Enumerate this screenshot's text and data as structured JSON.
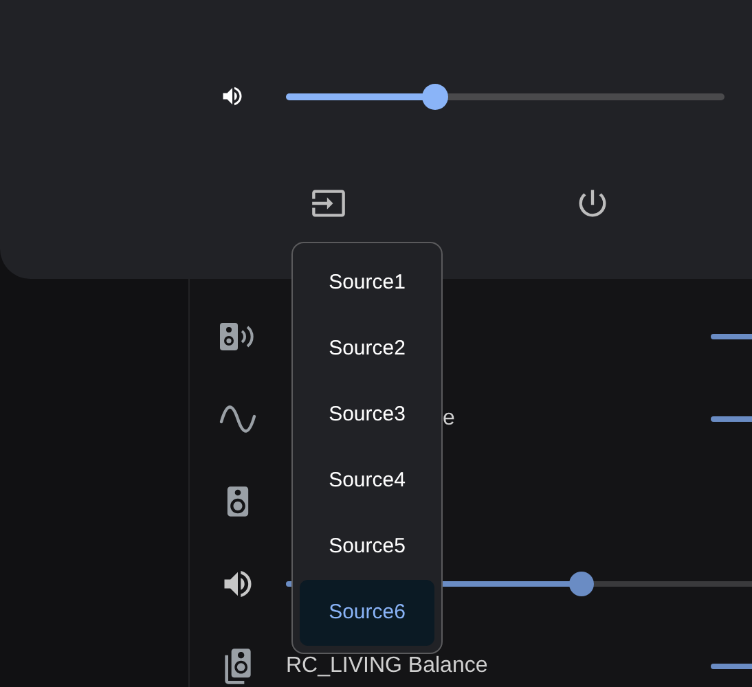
{
  "top_panel": {
    "volume": {
      "level": 0.34
    },
    "buttons": [
      {
        "kind": "input"
      },
      {
        "kind": "power"
      }
    ]
  },
  "rows": [
    {
      "kind": "edge_slider"
    },
    {
      "kind": "edge_slider",
      "label": "e"
    },
    {
      "kind": "plain"
    },
    {
      "kind": "slider",
      "level": 0.6
    },
    {
      "kind": "edge_slider",
      "label": "RC_LIVING Balance"
    }
  ],
  "source_menu": {
    "items": [
      {
        "label": "Source1",
        "selected": false
      },
      {
        "label": "Source2",
        "selected": false
      },
      {
        "label": "Source3",
        "selected": false
      },
      {
        "label": "Source4",
        "selected": false
      },
      {
        "label": "Source5",
        "selected": false
      },
      {
        "label": "Source6",
        "selected": true
      }
    ]
  }
}
